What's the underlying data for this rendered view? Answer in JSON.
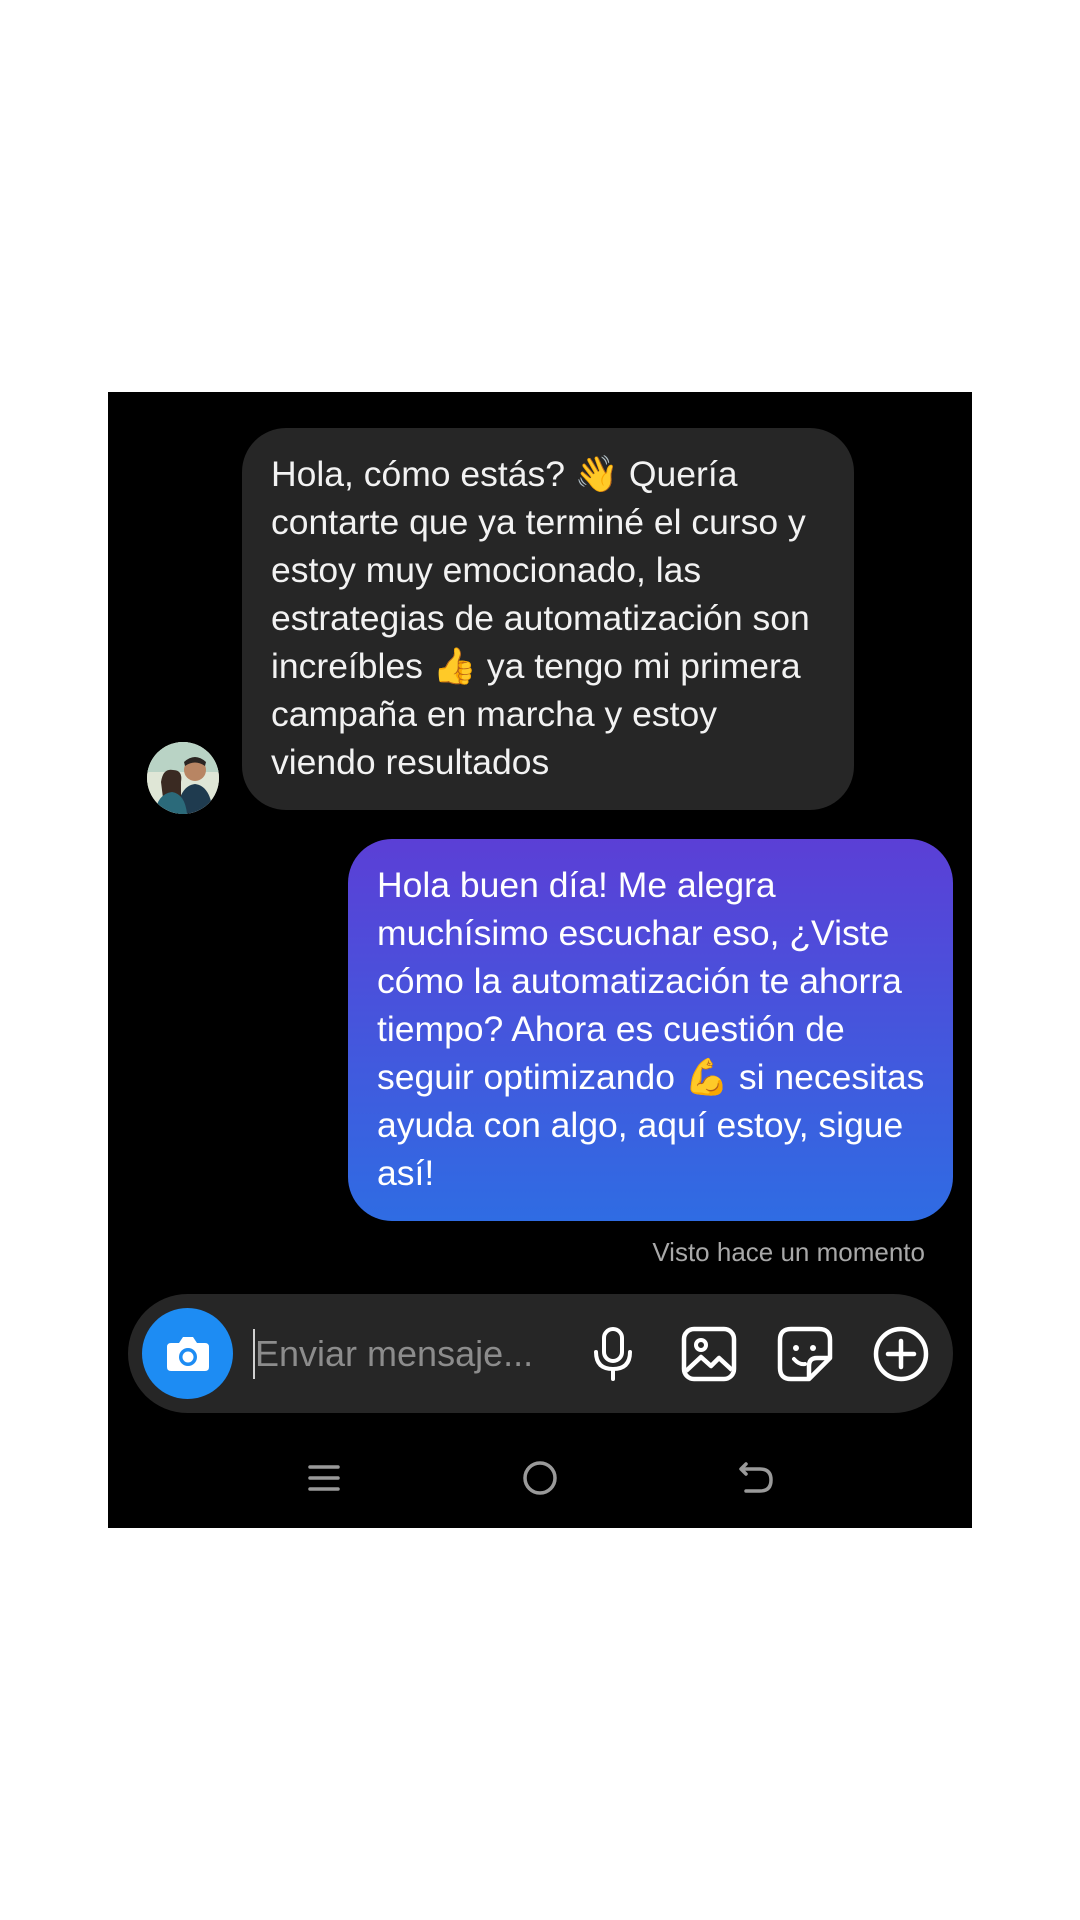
{
  "conversation": {
    "incoming": {
      "text": "Hola, cómo estás? 👋 Quería contarte que ya terminé el curso y estoy muy emocionado, las estrategias de automatización son increíbles 👍 ya tengo mi primera campaña en marcha y estoy viendo resultados"
    },
    "outgoing": {
      "text": "Hola buen día! Me alegra muchísimo escuchar eso, ¿Viste cómo la automatización te ahorra tiempo? Ahora es cuestión de seguir optimizando 💪 si necesitas ayuda con algo, aquí estoy, sigue así!"
    },
    "seen_status": "Visto hace un momento"
  },
  "composer": {
    "placeholder": "Enviar mensaje...",
    "icons": [
      "camera-icon",
      "microphone-icon",
      "gallery-icon",
      "sticker-icon",
      "add-icon"
    ],
    "accent_color": "#1d8cf3"
  },
  "navigation": {
    "icons": [
      "menu-icon",
      "home-icon",
      "back-icon"
    ]
  },
  "colors": {
    "incoming_bubble": "#262626",
    "outgoing_gradient_top": "#5b3fd6",
    "outgoing_gradient_bottom": "#2f6ce3",
    "background": "#000000"
  }
}
